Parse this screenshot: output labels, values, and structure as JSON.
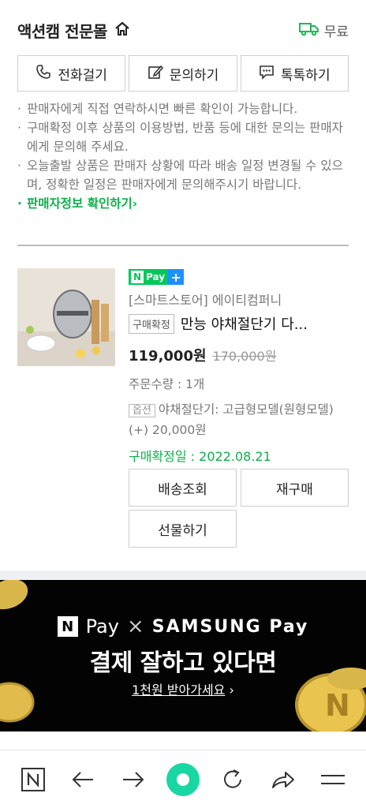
{
  "header": {
    "store_name": "액션캠 전문몰",
    "shipping_label": "무료"
  },
  "contact": {
    "call_label": "전화걸기",
    "inquiry_label": "문의하기",
    "talk_label": "톡톡하기"
  },
  "notes": [
    "판매자에게 직접 연락하시면 빠른 확인이 가능합니다.",
    "구매확정 이후 상품의 이용방법, 반품 등에 대한 문의는 판매자에게 문의해 주세요.",
    "오늘출발 상품은 판매자 상황에 따라 배송 일정 변경될 수 있으며, 정확한 일정은 판매자에게 문의해주시기 바랍니다."
  ],
  "seller_info_link": "판매자정보 확인하기",
  "order": {
    "npay_badge": "Pay",
    "seller": "[스마트스토어] 에이티컴퍼니",
    "status_tag": "구매확정",
    "product_title": "만능 야채절단기 다...",
    "price": "119,000원",
    "original_price": "170,000원",
    "quantity": "주문수량 : 1개",
    "option_tag": "옵션",
    "option_text": "야채절단기: 고급형모델(원형모델) (+) 20,000원",
    "confirmed_date": "구매확정일 : 2022.08.21"
  },
  "actions": {
    "tracking": "배송조회",
    "rebuy": "재구매",
    "gift": "선물하기"
  },
  "banner": {
    "npay": "Pay",
    "samsung_pay": "SAMSUNG Pay",
    "headline": "결제 잘하고 있다면",
    "cta": "1천원 받아가세요"
  },
  "colors": {
    "accent_green": "#0db04b",
    "npay_green": "#03c75a",
    "banner_bg": "#030303"
  }
}
